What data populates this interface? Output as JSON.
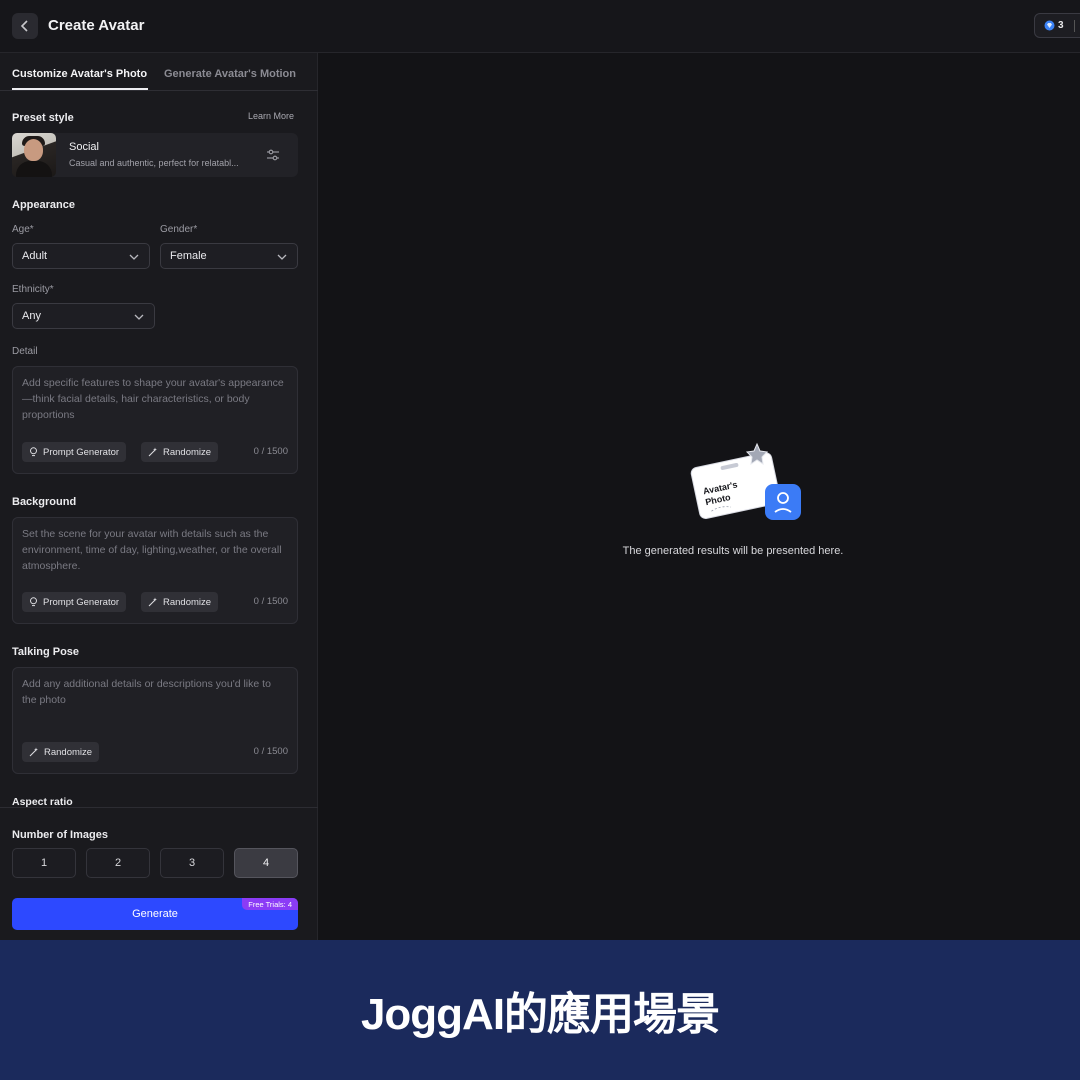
{
  "header": {
    "title": "Create Avatar",
    "credits": "3"
  },
  "tabs": [
    {
      "label": "Customize Avatar's Photo",
      "active": true
    },
    {
      "label": "Generate Avatar's Motion",
      "active": false
    }
  ],
  "preset": {
    "section_label": "Preset style",
    "learn_more": "Learn More",
    "name": "Social",
    "description": "Casual and authentic, perfect for relatabl..."
  },
  "appearance": {
    "section_label": "Appearance",
    "age_label": "Age*",
    "age_value": "Adult",
    "gender_label": "Gender*",
    "gender_value": "Female",
    "ethnicity_label": "Ethnicity*",
    "ethnicity_value": "Any",
    "detail_label": "Detail",
    "detail_placeholder": "Add specific features to shape your avatar's appearance—think facial details, hair characteristics, or body proportions",
    "prompt_generator": "Prompt Generator",
    "randomize": "Randomize",
    "counter": "0 / 1500"
  },
  "background": {
    "section_label": "Background",
    "placeholder": "Set the scene for your avatar with details such as the environment, time of day, lighting,weather, or the overall atmosphere.",
    "prompt_generator": "Prompt Generator",
    "randomize": "Randomize",
    "counter": "0 / 1500"
  },
  "talking_pose": {
    "section_label": "Talking Pose",
    "placeholder": "Add any additional details or descriptions you'd like to the photo",
    "randomize": "Randomize",
    "counter": "0 / 1500"
  },
  "aspect_ratio": {
    "section_label": "Aspect ratio"
  },
  "number_of_images": {
    "section_label": "Number of Images",
    "options": [
      "1",
      "2",
      "3",
      "4"
    ],
    "selected": "4"
  },
  "generate": {
    "label": "Generate",
    "badge": "Free Trials: 4"
  },
  "results": {
    "illustration_label": "Avatar's Photo",
    "empty_message": "The generated results will be presented here."
  },
  "banner": {
    "text": "JoggAI的應用場景"
  },
  "colors": {
    "accent": "#2d49ff",
    "badge": "#8b3cf6",
    "banner_bg": "#1b2a5c"
  }
}
